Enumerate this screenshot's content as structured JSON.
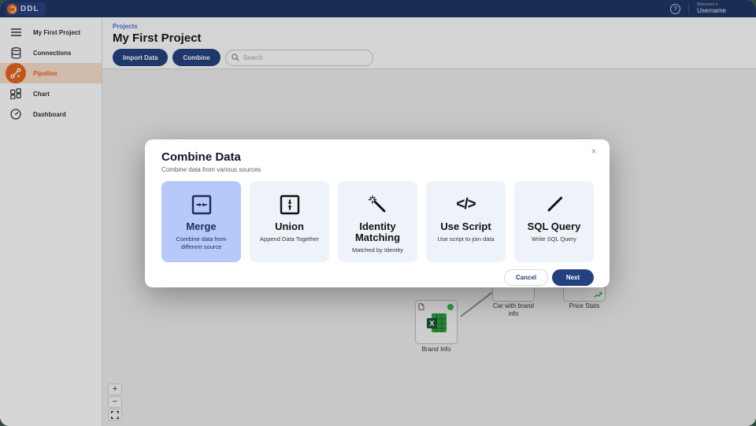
{
  "colors": {
    "navy": "#24407e",
    "navbar": "#1d3564",
    "accent_orange": "#e2661f",
    "selected_card_blue": "#b7c9f8",
    "status_green": "#3fae4a",
    "page_background_green": "#2d4a3c"
  },
  "navbar": {
    "logo_text": "DDL",
    "help_icon": "?",
    "welcome_label": "Welcome! ▾",
    "username": "Username"
  },
  "sidebar": {
    "items": [
      {
        "label": "My First Project",
        "icon": "hamburger-icon",
        "active": false
      },
      {
        "label": "Connections",
        "icon": "database-icon",
        "active": false
      },
      {
        "label": "Pipeline",
        "icon": "pipeline-icon",
        "active": true
      },
      {
        "label": "Chart",
        "icon": "chart-grid-icon",
        "active": false
      },
      {
        "label": "Dashboard",
        "icon": "gauge-icon",
        "active": false
      }
    ]
  },
  "header": {
    "breadcrumb": "Projects",
    "title": "My First Project",
    "import_button": "Import Data",
    "combine_button": "Combine",
    "search_placeholder": "Search"
  },
  "canvas": {
    "nodes": [
      {
        "label": "Brand Info",
        "type": "excel-source",
        "status": "green"
      },
      {
        "label": "Car with brand info",
        "type": "table"
      },
      {
        "label": "Price Stats",
        "type": "table-chart"
      }
    ],
    "zoom_controls": {
      "zoom_in": "+",
      "zoom_out": "−"
    }
  },
  "modal": {
    "title": "Combine Data",
    "subtitle": "Combine data from various sources",
    "close": "×",
    "options": [
      {
        "title": "Merge",
        "description": "Combine data from different source",
        "icon": "merge-icon",
        "selected": true
      },
      {
        "title": "Union",
        "description": "Append Data Together",
        "icon": "union-icon",
        "selected": false
      },
      {
        "title": "Identity Matching",
        "description": "Matched by Identity",
        "icon": "wand-icon",
        "selected": false
      },
      {
        "title": "Use Script",
        "description": "Use script to join data",
        "icon": "code-icon",
        "selected": false
      },
      {
        "title": "SQL Query",
        "description": "Write SQL Query",
        "icon": "pencil-icon",
        "selected": false
      }
    ],
    "cancel_button": "Cancel",
    "next_button": "Next"
  }
}
